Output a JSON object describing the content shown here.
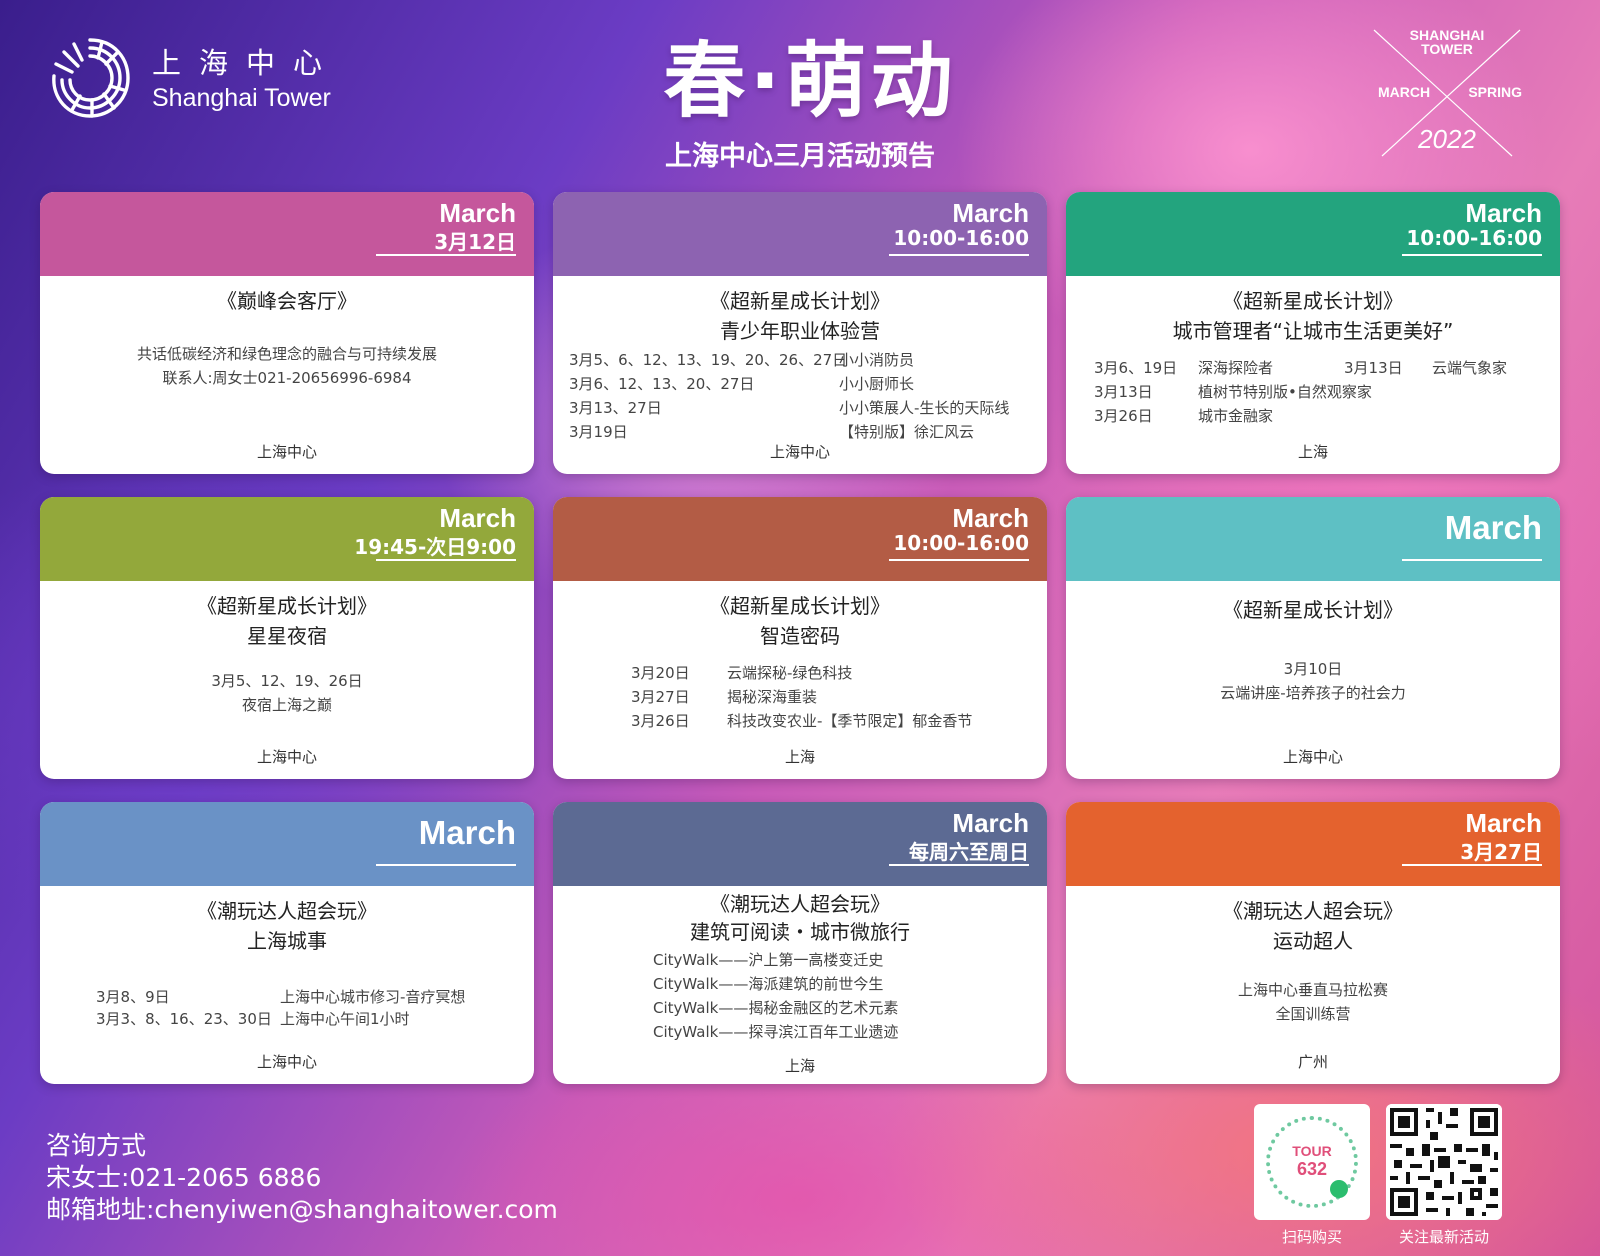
{
  "logo": {
    "cn": "上海中心",
    "en": "Shanghai Tower"
  },
  "header": {
    "title": "春·萌动",
    "subtitle": "上海中心三月活动预告"
  },
  "badge": {
    "tower": "SHANGHAI TOWER",
    "left": "MARCH",
    "right": "SPRING",
    "year": "2022"
  },
  "colors": {
    "magenta": "#c5579c",
    "purple": "#8d63b1",
    "green": "#23a47e",
    "olive": "#93a83b",
    "brick": "#b35c45",
    "teal": "#5ec0c4",
    "steel": "#6a92c6",
    "slate": "#5c6a93",
    "orange": "#e4622e"
  },
  "cards": [
    {
      "month": "March",
      "sub": "3月12日",
      "title1": "《巅峰会客厅》",
      "lines": [
        "共话低碳经济和绿色理念的融合与可持续发展",
        "联系人:周女士021-20656996-6984"
      ],
      "location": "上海中心"
    },
    {
      "month": "March",
      "sub": "10:00-16:00",
      "title1": "《超新星成长计划》",
      "title2": "青少年职业体验营",
      "rows": [
        [
          "3月5、6、12、13、19、20、26、27日",
          "小小消防员"
        ],
        [
          "3月6、12、13、20、27日",
          "小小厨师长"
        ],
        [
          "3月13、27日",
          "小小策展人-生长的天际线"
        ],
        [
          "3月19日",
          "【特别版】徐汇风云"
        ]
      ],
      "location": "上海中心"
    },
    {
      "month": "March",
      "sub": "10:00-16:00",
      "title1": "《超新星成长计划》",
      "title2": "城市管理者“让城市生活更美好”",
      "rows": [
        [
          "3月6、19日",
          "深海探险者",
          "3月13日",
          "云端气象家"
        ],
        [
          "3月13日",
          "植树节特别版•自然观察家",
          "",
          ""
        ],
        [
          "3月26日",
          "城市金融家",
          "",
          ""
        ]
      ],
      "location": "上海"
    },
    {
      "month": "March",
      "sub": "19:45-次日9:00",
      "title1": "《超新星成长计划》",
      "title2": "星星夜宿",
      "lines": [
        "3月5、12、19、26日",
        "夜宿上海之巅"
      ],
      "location": "上海中心"
    },
    {
      "month": "March",
      "sub": "10:00-16:00",
      "title1": "《超新星成长计划》",
      "title2": "智造密码",
      "rows": [
        [
          "3月20日",
          "云端探秘-绿色科技"
        ],
        [
          "3月27日",
          "揭秘深海重装"
        ],
        [
          "3月26日",
          "科技改变农业-【季节限定】郁金香节"
        ]
      ],
      "location": "上海"
    },
    {
      "month": "March",
      "sub": "",
      "title1": "《超新星成长计划》",
      "lines": [
        "3月10日",
        "云端讲座-培养孩子的社会力"
      ],
      "location": "上海中心"
    },
    {
      "month": "March",
      "sub": "",
      "title1": "《潮玩达人超会玩》",
      "title2": "上海城事",
      "rows": [
        [
          "3月8、9日",
          "上海中心城市修习-音疗冥想"
        ],
        [
          "3月3、8、16、23、30日",
          "上海中心午间1小时"
        ]
      ],
      "location": "上海中心"
    },
    {
      "month": "March",
      "sub": "每周六至周日",
      "title1": "《潮玩达人超会玩》",
      "title2": "建筑可阅读・城市微旅行",
      "citywalk": [
        "CityWalk——沪上第一高楼变迁史",
        "CityWalk——海派建筑的前世今生",
        "CityWalk——揭秘金融区的艺术元素",
        "CityWalk——探寻滨江百年工业遗迹"
      ],
      "location": "上海"
    },
    {
      "month": "March",
      "sub": "3月27日",
      "title1": "《潮玩达人超会玩》",
      "title2": "运动超人",
      "lines": [
        "上海中心垂直马拉松赛",
        "全国训练营"
      ],
      "location": "广州"
    }
  ],
  "footer": {
    "contact_title": "咨询方式",
    "contact_phone": "宋女士:021-2065 6886",
    "contact_email": "邮箱地址:chenyiwen@shanghaitower.com",
    "qr1_brand": "TOUR",
    "qr1_num": "632",
    "qr1_caption": "扫码购买",
    "qr2_caption": "关注最新活动"
  }
}
